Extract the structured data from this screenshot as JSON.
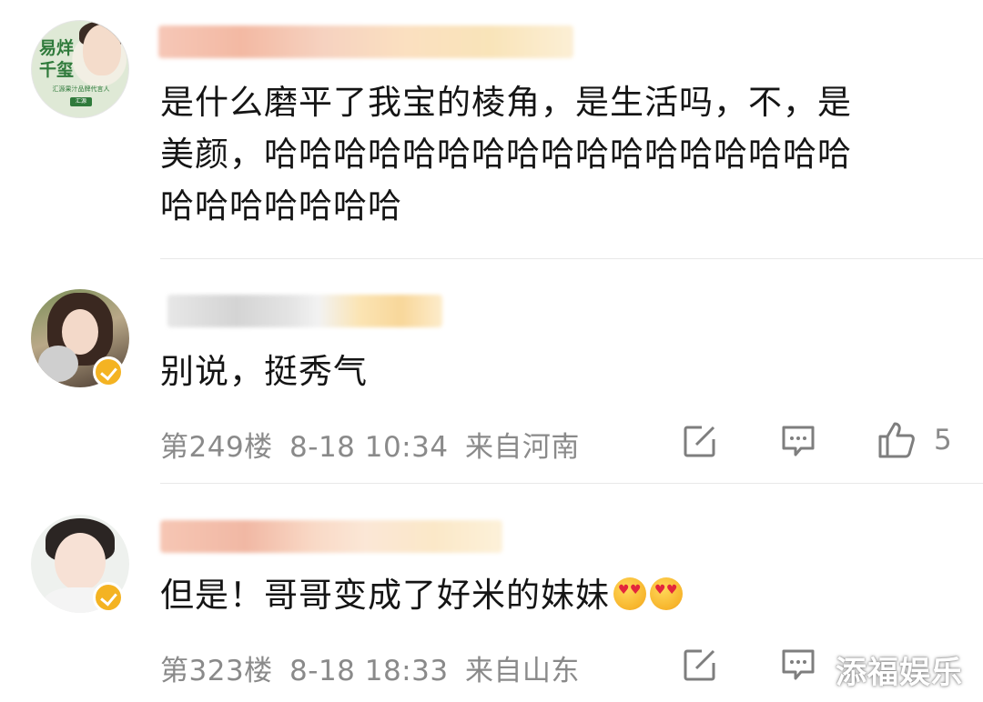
{
  "comments": [
    {
      "text_lines": [
        "是什么磨平了我宝的棱角，是生活吗，不，是",
        "美颜，哈哈哈哈哈哈哈哈哈哈哈哈哈哈哈哈哈",
        "哈哈哈哈哈哈哈"
      ],
      "avatar": {
        "lines": [
          "易烊",
          "千玺"
        ],
        "subtitle": "汇源果汁品牌代言人",
        "logo": "汇源"
      }
    },
    {
      "text": "别说，挺秀气",
      "floor": "第249楼",
      "time": "8-18 10:34",
      "location": "来自河南",
      "likes": "5",
      "verified": true
    },
    {
      "text": "但是！哥哥变成了好米的妹妹",
      "emoji": [
        "heart-eyes-emoji",
        "heart-eyes-emoji"
      ],
      "floor": "第323楼",
      "time": "8-18 18:33",
      "location": "来自山东",
      "verified": true
    }
  ],
  "icons": {
    "repost": "edit-square-icon",
    "reply": "comment-bubble-icon",
    "like": "thumbs-up-icon"
  },
  "colors": {
    "meta_gray": "#8a8a8a",
    "verified": "#f4b322",
    "divider": "#e8e8e8"
  },
  "watermark": "添福娱乐"
}
